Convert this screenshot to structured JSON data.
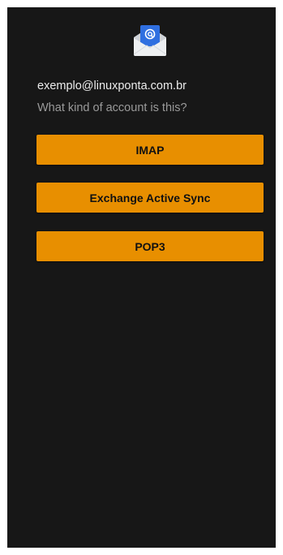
{
  "account": {
    "email": "exemplo@linuxponta.com.br",
    "question": "What kind of account is this?"
  },
  "account_types": {
    "imap_label": "IMAP",
    "exchange_label": "Exchange Active Sync",
    "pop3_label": "POP3"
  },
  "logo": {
    "icon": "email-envelope-at-icon"
  },
  "colors": {
    "background": "#171717",
    "button": "#e88f00",
    "button_text": "#111111",
    "primary_text": "#ececec",
    "secondary_text": "#9a9a9a",
    "logo_blue": "#2f6fe0"
  }
}
